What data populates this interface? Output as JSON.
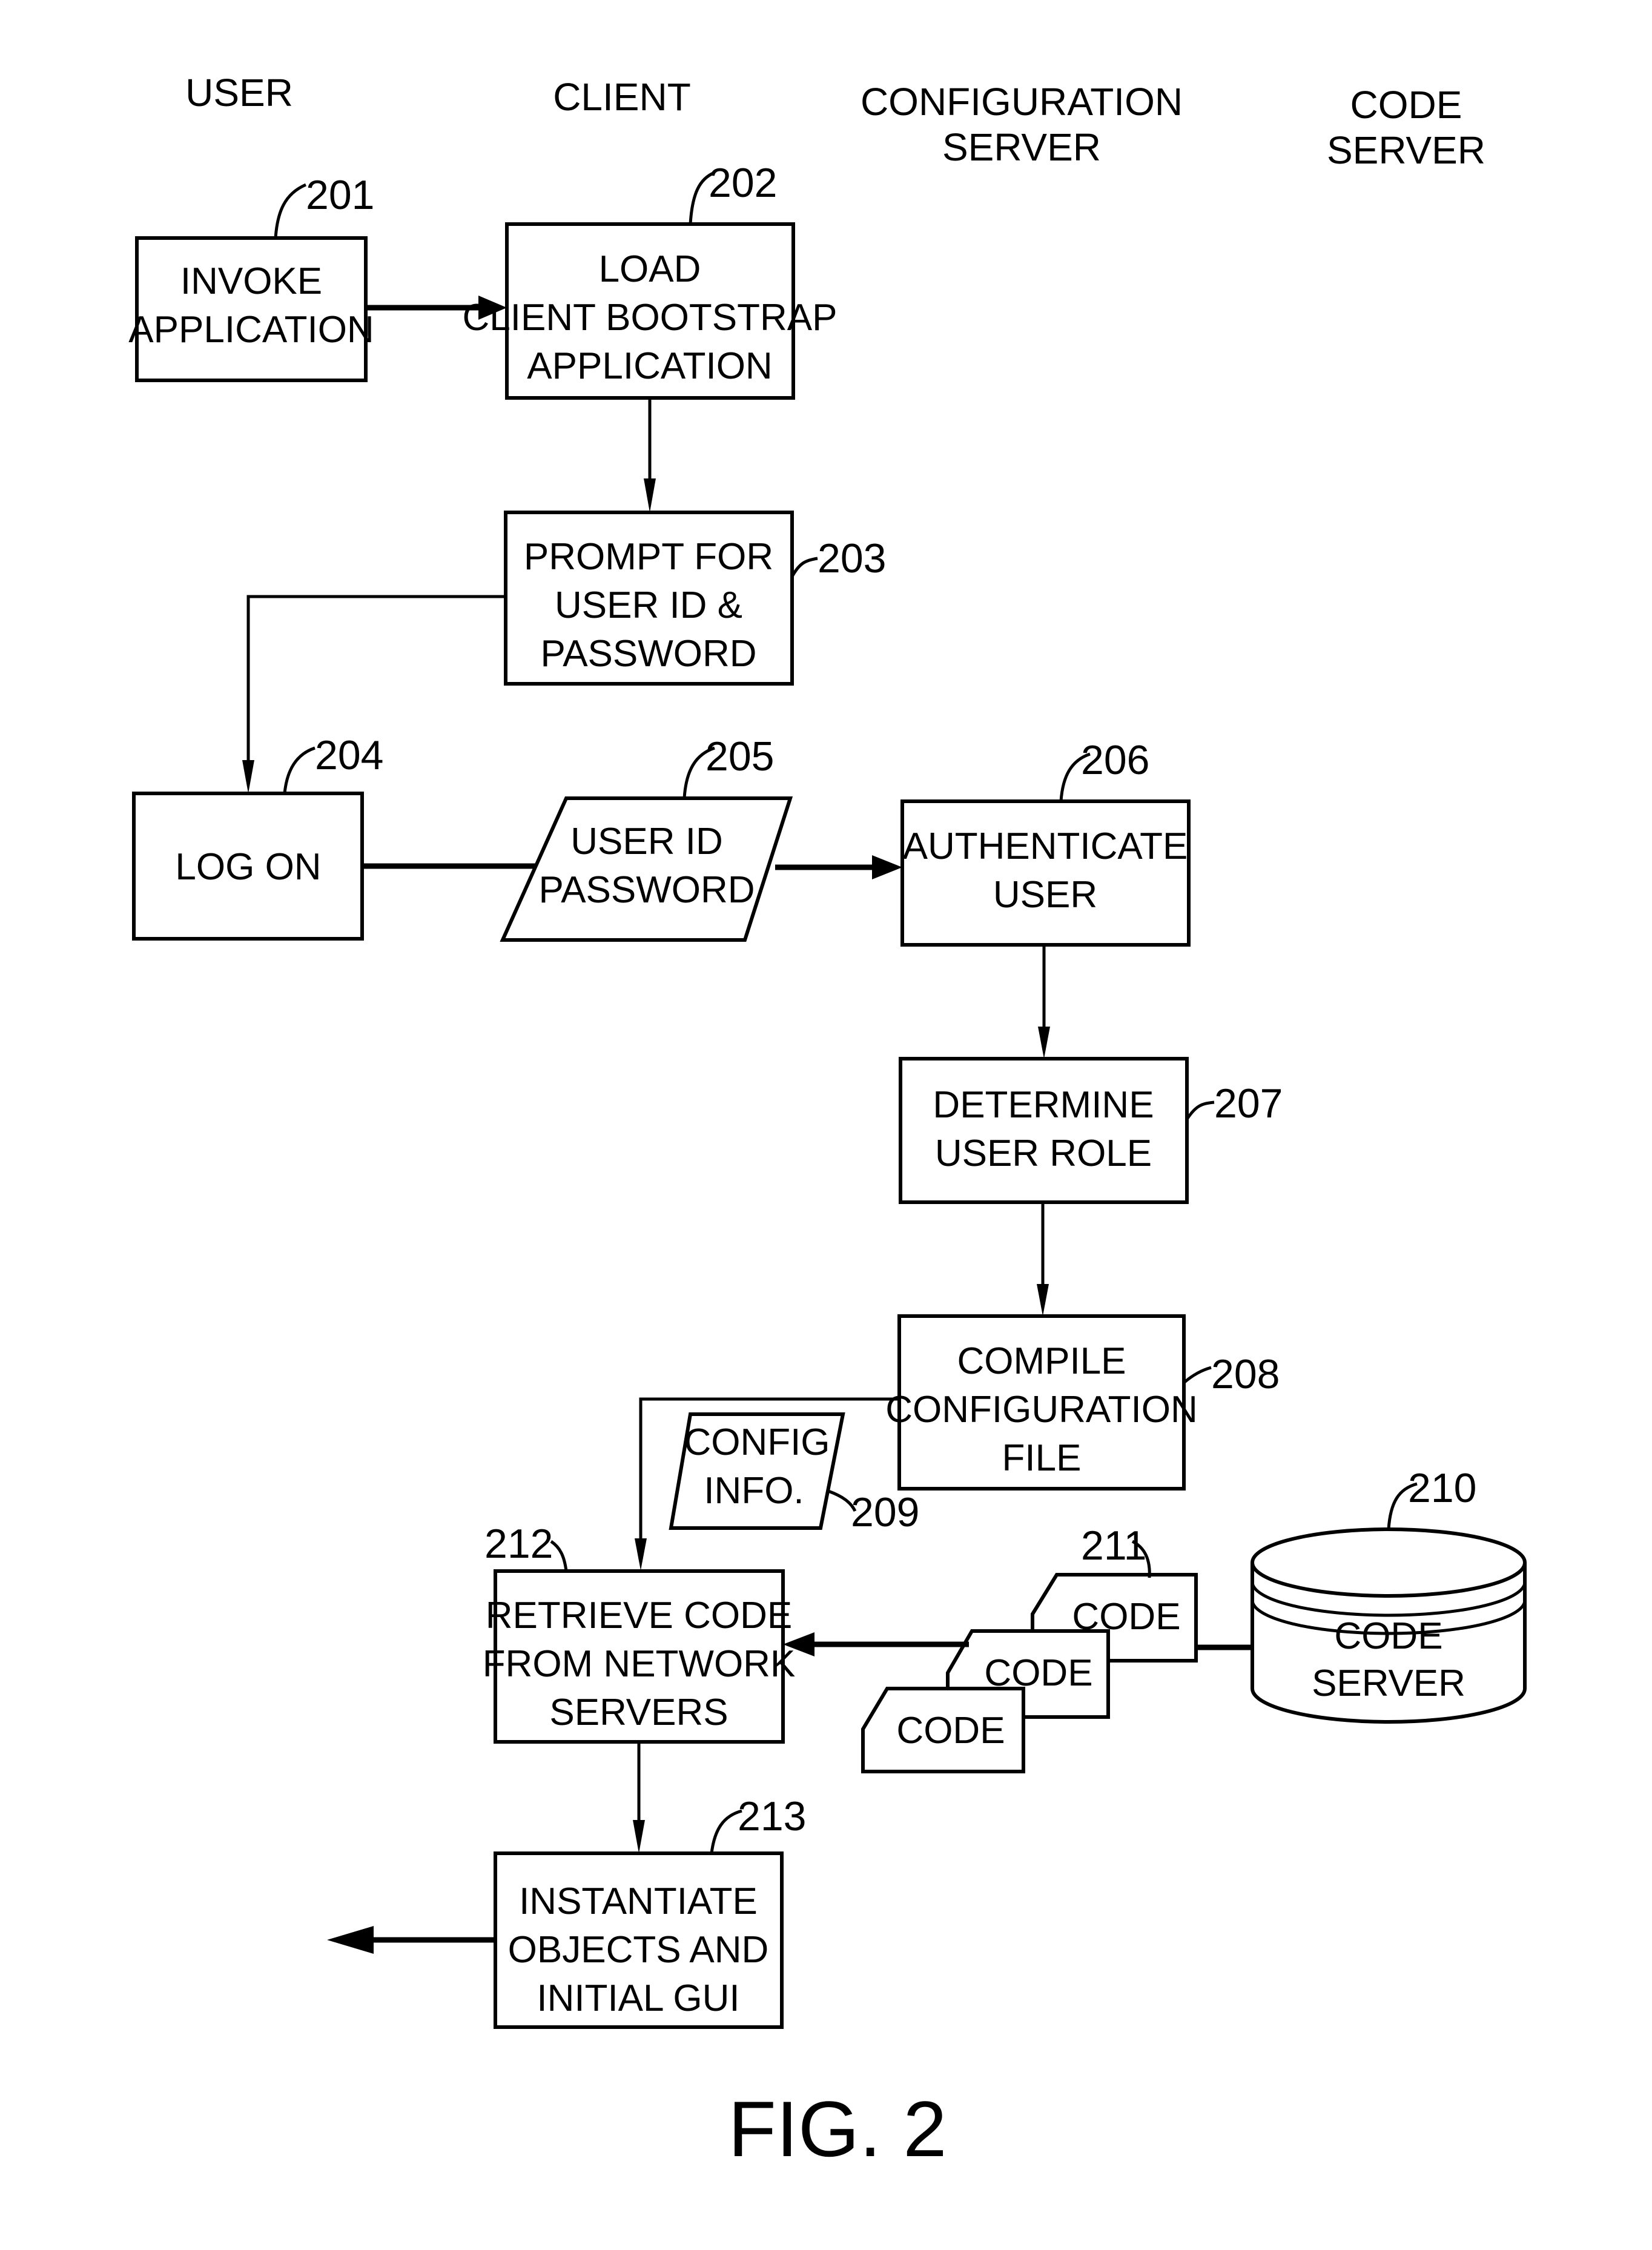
{
  "lanes": {
    "user": [
      "USER"
    ],
    "client": [
      "CLIENT"
    ],
    "configuration_server": [
      "CONFIGURATION",
      "SERVER"
    ],
    "code_server": [
      "CODE",
      "SERVER"
    ]
  },
  "steps": {
    "s201": {
      "ref": "201",
      "lines": [
        "INVOKE",
        "APPLICATION"
      ]
    },
    "s202": {
      "ref": "202",
      "lines": [
        "LOAD",
        "CLIENT  BOOTSTRAP",
        "APPLICATION"
      ]
    },
    "s203": {
      "ref": "203",
      "lines": [
        "PROMPT  FOR",
        "USER  ID  &",
        "PASSWORD"
      ]
    },
    "s204": {
      "ref": "204",
      "lines": [
        "LOG  ON"
      ]
    },
    "s205": {
      "ref": "205",
      "lines": [
        "USER  ID",
        "PASSWORD"
      ]
    },
    "s206": {
      "ref": "206",
      "lines": [
        "AUTHENTICATE",
        "USER"
      ]
    },
    "s207": {
      "ref": "207",
      "lines": [
        "DETERMINE",
        "USER  ROLE"
      ]
    },
    "s208": {
      "ref": "208",
      "lines": [
        "COMPILE",
        "CONFIGURATION",
        "FILE"
      ]
    },
    "s209": {
      "ref": "209",
      "lines": [
        "CONFIG",
        "INFO."
      ]
    },
    "s210": {
      "ref": "210",
      "lines": [
        "CODE",
        "SERVER"
      ]
    },
    "s211": {
      "ref": "211",
      "cards": [
        "CODE",
        "CODE",
        "CODE"
      ]
    },
    "s212": {
      "ref": "212",
      "lines": [
        "RETRIEVE  CODE",
        "FROM  NETWORK",
        "SERVERS"
      ]
    },
    "s213": {
      "ref": "213",
      "lines": [
        "INSTANTIATE",
        "OBJECTS  AND",
        "INITIAL  GUI"
      ]
    }
  },
  "figure_label": "FIG.  2"
}
